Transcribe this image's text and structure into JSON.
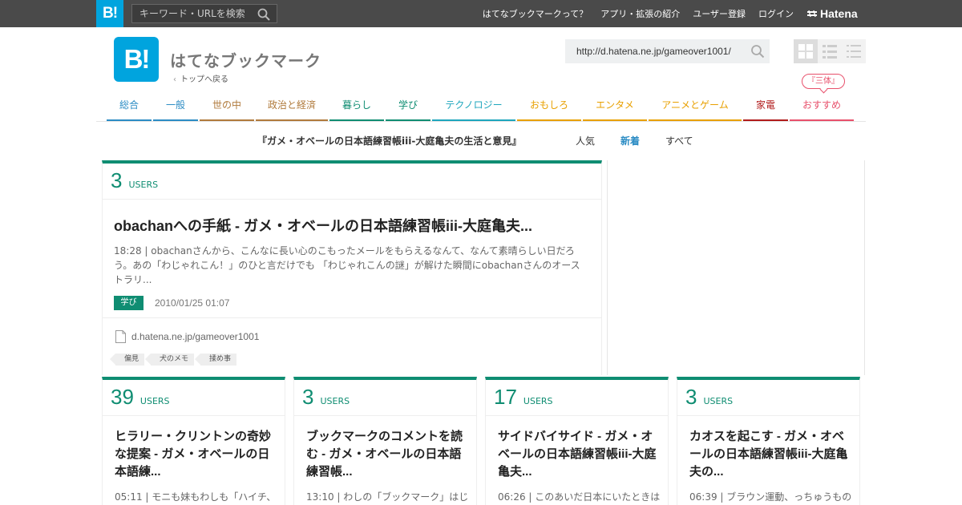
{
  "topbar": {
    "logo": "B!",
    "search_placeholder": "キーワード・URLを検索",
    "links": [
      "はてなブックマークって？",
      "アプリ・拡張の紹介",
      "ユーザー登録",
      "ログイン"
    ],
    "hatena": "Hatena"
  },
  "header": {
    "logo": "B!",
    "title": "はてなブックマーク",
    "back_link": "トップへ戻る",
    "url_value": "http://d.hatena.ne.jp/gameover1001/"
  },
  "categories": [
    {
      "label": "総合",
      "color": "#2b8cc4"
    },
    {
      "label": "一般",
      "color": "#2b8cc4"
    },
    {
      "label": "世の中",
      "color": "#b07a3c"
    },
    {
      "label": "政治と経済",
      "color": "#b07a3c"
    },
    {
      "label": "暮らし",
      "color": "#0f8d72"
    },
    {
      "label": "学び",
      "color": "#0f8d72"
    },
    {
      "label": "テクノロジー",
      "color": "#1ea6bd"
    },
    {
      "label": "おもしろ",
      "color": "#e8a000"
    },
    {
      "label": "エンタメ",
      "color": "#e8a000"
    },
    {
      "label": "アニメとゲーム",
      "color": "#e8a000"
    },
    {
      "label": "家電",
      "color": "#b11b1b"
    },
    {
      "label": "おすすめ",
      "color": "#e8506b"
    }
  ],
  "recommend_pill": "『三体』",
  "subnav": {
    "title": "『ガメ・オベールの日本語練習帳iii-大庭亀夫の生活と意見』",
    "tabs": [
      "人気",
      "新着",
      "すべて"
    ]
  },
  "main_entry": {
    "users_count": "3",
    "users_label": "USERS",
    "title": "obachanへの手紙 - ガメ・オベールの日本語練習帳iii-大庭亀夫...",
    "desc": "18:28 | obachanさんから、こんなに長い心のこもったメールをもらえるなんて、なんて素晴らしい日だろう。あの「わじゃれこん！」のひと言だけでも 「わじゃれこんの謎」が解けた瞬間にobachanさんのオーストラリ...",
    "category": "学び",
    "date": "2010/01/25 01:07",
    "domain": "d.hatena.ne.jp/gameover1001",
    "tags": [
      "偏見",
      "犬のメモ",
      "揉め事"
    ]
  },
  "entries": [
    {
      "users_count": "39",
      "users_label": "USERS",
      "title": "ヒラリー・クリントンの奇妙な提案 - ガメ・オベールの日本語練...",
      "desc": "05:11 | モニも妹もわしも「ハイチ、"
    },
    {
      "users_count": "3",
      "users_label": "USERS",
      "title": "ブックマークのコメントを読む - ガメ・オベールの日本語練習帳...",
      "desc": "13:10 | わしの「ブックマーク」はじ"
    },
    {
      "users_count": "17",
      "users_label": "USERS",
      "title": "サイドバイサイド - ガメ・オベールの日本語練習帳iii-大庭亀夫...",
      "desc": "06:26 | このあいだ日本にいたときは"
    },
    {
      "users_count": "3",
      "users_label": "USERS",
      "title": "カオスを起こす - ガメ・オベールの日本語練習帳iii-大庭亀夫の...",
      "desc": "06:39 | ブラウン運動、っちゅうもの"
    }
  ],
  "colors": {
    "accent": "#0f8d72",
    "brand": "#00a4de",
    "topbar": "#4a4a4a"
  }
}
